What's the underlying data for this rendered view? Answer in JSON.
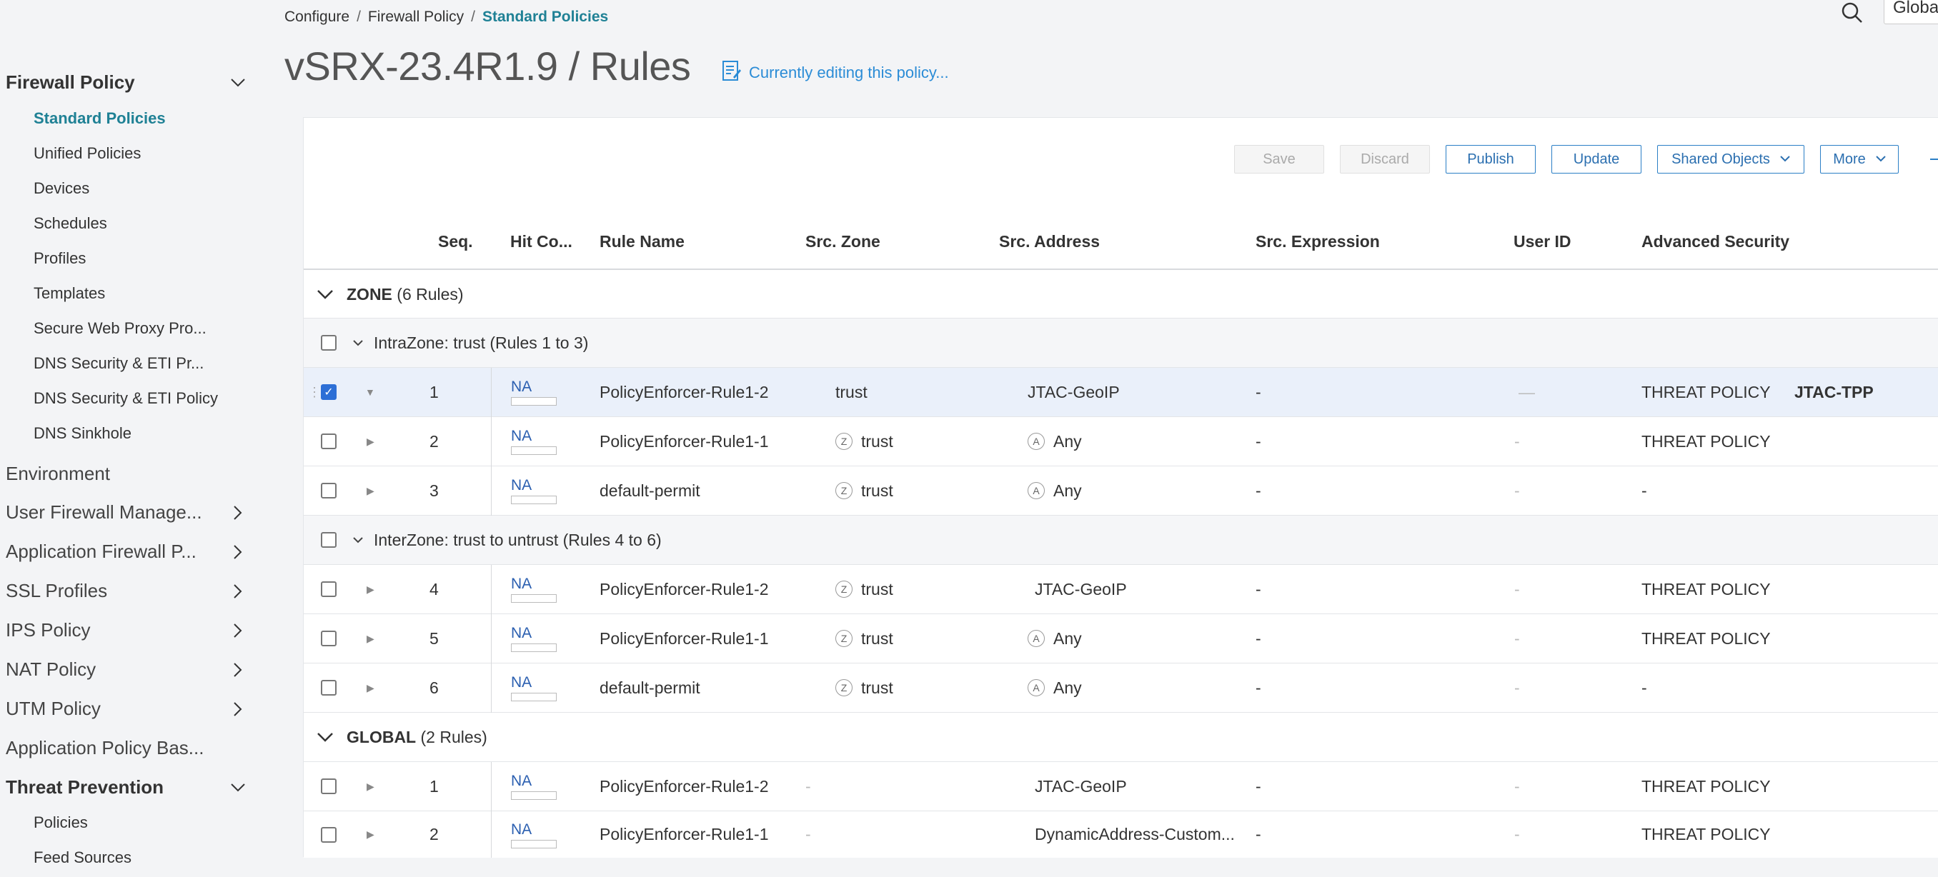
{
  "sidebar": {
    "firewall_policy": "Firewall Policy",
    "sub_items": [
      "Standard Policies",
      "Unified Policies",
      "Devices",
      "Schedules",
      "Profiles",
      "Templates",
      "Secure Web Proxy Pro...",
      "DNS Security & ETI Pr...",
      "DNS Security & ETI Policy",
      "DNS Sinkhole"
    ],
    "environment": "Environment",
    "user_firewall": "User Firewall Manage...",
    "application_firewall": "Application Firewall P...",
    "ssl_profiles": "SSL Profiles",
    "ips_policy": "IPS Policy",
    "nat_policy": "NAT Policy",
    "utm_policy": "UTM Policy",
    "application_policy": "Application Policy Bas...",
    "threat_prevention": "Threat Prevention",
    "threat_sub": [
      "Policies",
      "Feed Sources"
    ]
  },
  "breadcrumb": {
    "configure": "Configure",
    "firewall_policy": "Firewall Policy",
    "current": "Standard Policies",
    "sep": "/"
  },
  "title": "vSRX-23.4R1.9 / Rules",
  "editing": "Currently editing this policy...",
  "global_label": "Global",
  "toolbar": {
    "save": "Save",
    "discard": "Discard",
    "publish": "Publish",
    "update": "Update",
    "shared_objects": "Shared Objects",
    "more": "More"
  },
  "columns": {
    "seq": "Seq.",
    "hit": "Hit Co...",
    "rule_name": "Rule Name",
    "src_zone": "Src. Zone",
    "src_address": "Src. Address",
    "src_expression": "Src. Expression",
    "user_id": "User ID",
    "advanced_security": "Advanced Security"
  },
  "groups": {
    "zone": {
      "name": "ZONE",
      "count": "(6 Rules)"
    },
    "intrazone": "IntraZone: trust (Rules 1 to 3)",
    "interzone": "InterZone: trust to untrust (Rules 4 to 6)",
    "global": {
      "name": "GLOBAL",
      "count": "(2 Rules)"
    }
  },
  "rules": [
    {
      "seq": "1",
      "hit": "NA",
      "name": "PolicyEnforcer-Rule1-2",
      "zone": "trust",
      "address": "JTAC-GeoIP",
      "expr": "-",
      "user": "—",
      "adv": "THREAT POLICY",
      "adv2": "JTAC-TPP"
    },
    {
      "seq": "2",
      "hit": "NA",
      "name": "PolicyEnforcer-Rule1-1",
      "zone": "trust",
      "address": "Any",
      "expr": "-",
      "user": "-",
      "adv": "THREAT POLICY",
      "adv2": ""
    },
    {
      "seq": "3",
      "hit": "NA",
      "name": "default-permit",
      "zone": "trust",
      "address": "Any",
      "expr": "-",
      "user": "-",
      "adv": "-",
      "adv2": ""
    },
    {
      "seq": "4",
      "hit": "NA",
      "name": "PolicyEnforcer-Rule1-2",
      "zone": "trust",
      "address": "JTAC-GeoIP",
      "expr": "-",
      "user": "-",
      "adv": "THREAT POLICY",
      "adv2": ""
    },
    {
      "seq": "5",
      "hit": "NA",
      "name": "PolicyEnforcer-Rule1-1",
      "zone": "trust",
      "address": "Any",
      "expr": "-",
      "user": "-",
      "adv": "THREAT POLICY",
      "adv2": ""
    },
    {
      "seq": "6",
      "hit": "NA",
      "name": "default-permit",
      "zone": "trust",
      "address": "Any",
      "expr": "-",
      "user": "-",
      "adv": "-",
      "adv2": ""
    },
    {
      "seq": "1",
      "hit": "NA",
      "name": "PolicyEnforcer-Rule1-2",
      "zone": "-",
      "address": "JTAC-GeoIP",
      "expr": "-",
      "user": "-",
      "adv": "THREAT POLICY",
      "adv2": ""
    },
    {
      "seq": "2",
      "hit": "NA",
      "name": "PolicyEnforcer-Rule1-1",
      "zone": "-",
      "address": "DynamicAddress-Custom...",
      "expr": "-",
      "user": "-",
      "adv": "THREAT POLICY",
      "adv2": ""
    }
  ],
  "badges": {
    "zone": "Z",
    "address": "A"
  },
  "colors": {
    "accent": "#1f8195",
    "link": "#2b8cd6",
    "selected_row": "#eaf0fa",
    "checkbox": "#2d6fd6"
  }
}
